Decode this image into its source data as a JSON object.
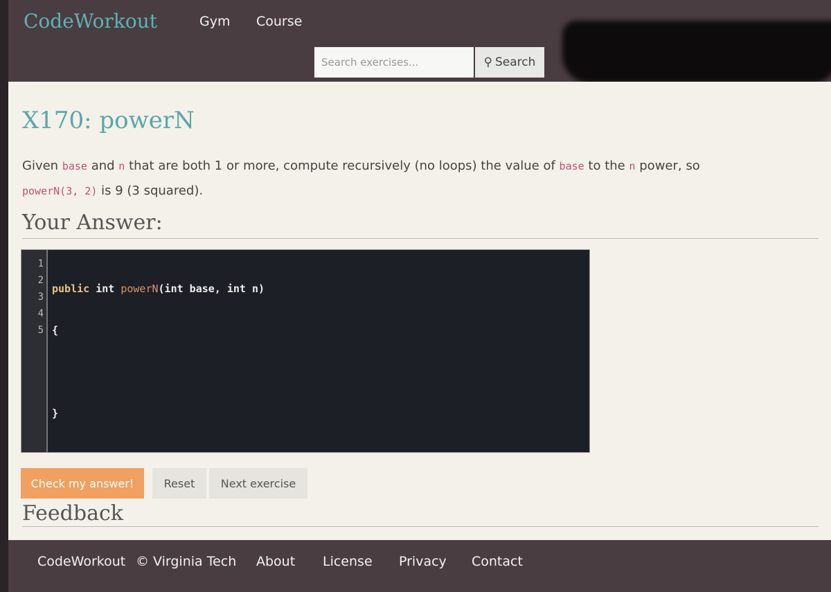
{
  "navbar": {
    "brand": "CodeWorkout",
    "links": [
      "Gym",
      "Course"
    ],
    "search_placeholder": "Search exercises...",
    "search_button": "Search"
  },
  "exercise": {
    "title": "X170: powerN",
    "desc": {
      "p1": "Given",
      "c1": "base",
      "p2": "and",
      "c2": "n",
      "p3": "that are both 1 or more, compute recursively (no loops) the value of",
      "c3": "base",
      "p4": "to the",
      "c4": "n",
      "p5": "power, so",
      "c5": "powerN(3, 2)",
      "p6": "is 9 (3 squared)."
    },
    "answer_heading": "Your Answer:",
    "code": {
      "line_numbers": [
        "1",
        "2",
        "3",
        "4",
        "5"
      ],
      "line1": {
        "kw1": "public",
        "kw2": "int",
        "fn": "powerN",
        "rest": "(int base, int n)"
      },
      "line2": "{",
      "line3": "",
      "line4": "}",
      "line5": ""
    },
    "buttons": {
      "check": "Check my answer!",
      "reset": "Reset",
      "next": "Next exercise"
    },
    "feedback_heading": "Feedback"
  },
  "footer": {
    "links": [
      "CodeWorkout",
      "© Virginia Tech",
      "About",
      "License",
      "Privacy",
      "Contact"
    ]
  },
  "colors": {
    "navbar": "#4a3d42",
    "brand": "#5fb3b3",
    "check_button": "#f0a060",
    "editor_bg": "#1d1f26"
  }
}
